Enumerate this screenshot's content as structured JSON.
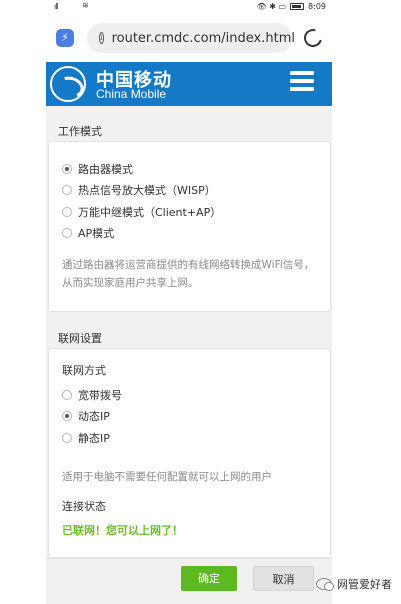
{
  "status_bar": {
    "signal": "ıll",
    "wifi": "≋",
    "icons": "👁 ✱ ▭",
    "time": "8:09"
  },
  "browser": {
    "url": "router.cmdc.com/index.html",
    "info_glyph": "i"
  },
  "header": {
    "brand_cn": "中国移动",
    "brand_en": "China Mobile"
  },
  "work_mode": {
    "title": "工作模式",
    "options": [
      {
        "label": "路由器模式",
        "selected": true
      },
      {
        "label": "热点信号放大模式（WISP）",
        "selected": false
      },
      {
        "label": "万能中继模式（Client+AP）",
        "selected": false
      },
      {
        "label": "AP模式",
        "selected": false
      }
    ],
    "description": "通过路由器将运营商提供的有线网络转换成WiFi信号，从而实现家庭用户共享上网。"
  },
  "network": {
    "title": "联网设置",
    "method_label": "联网方式",
    "options": [
      {
        "label": "宽带拨号",
        "selected": false
      },
      {
        "label": "动态IP",
        "selected": true
      },
      {
        "label": "静态IP",
        "selected": false
      }
    ],
    "description": "适用于电脑不需要任何配置就可以上网的用户",
    "status_label": "连接状态",
    "status_value": "已联网！您可以上网了！"
  },
  "footer": {
    "ok_label": "确定",
    "cancel_label": "取消"
  },
  "watermark": {
    "text": "网管爱好者"
  },
  "colors": {
    "brand_blue": "#1479c6",
    "confirm_green": "#5cba1f",
    "connected_green": "#6bbd2b"
  }
}
